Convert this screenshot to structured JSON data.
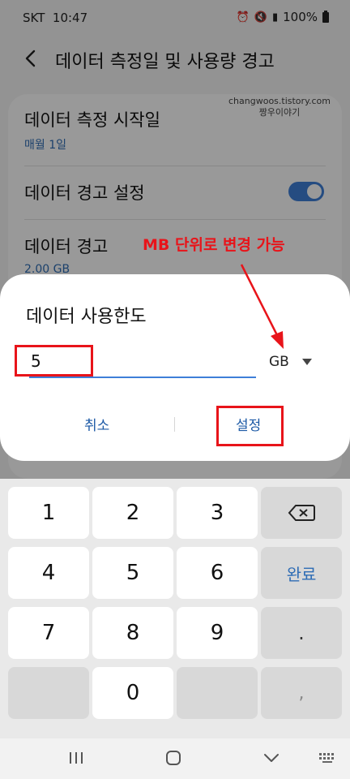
{
  "status_bar": {
    "carrier": "SKT",
    "time": "10:47",
    "battery": "100%",
    "icons": [
      "alarm-icon",
      "mute-icon",
      "signal-icon",
      "battery-icon"
    ]
  },
  "header": {
    "title": "데이터 측정일 및 사용량 경고",
    "back_icon": "chevron-left-icon"
  },
  "watermark": {
    "line1": "changwoos.tistory.com",
    "line2": "짱우이야기"
  },
  "settings": {
    "items": [
      {
        "title": "데이터 측정 시작일",
        "subtitle": "매월 1일"
      },
      {
        "title": "데이터 경고 설정",
        "toggle": true
      },
      {
        "title": "데이터 경고",
        "subtitle": "2.00 GB"
      }
    ]
  },
  "annotation": {
    "text": "MB 단위로 변경 가능",
    "color": "#e8141a"
  },
  "dialog": {
    "title": "데이터 사용한도",
    "input_value": "5",
    "unit": "GB",
    "cancel_label": "취소",
    "confirm_label": "설정"
  },
  "keyboard": {
    "keys": [
      "1",
      "2",
      "3",
      "4",
      "5",
      "6",
      "7",
      "8",
      "9",
      "0"
    ],
    "done_label": "완료",
    "dot_label": ".",
    "comma_label": ",",
    "backspace_icon": "backspace-icon"
  },
  "navbar": {
    "icons": [
      "recent-apps-icon",
      "home-icon",
      "back-down-icon",
      "keyboard-icon"
    ]
  },
  "colors": {
    "accent": "#3e7fd8",
    "link": "#1d5aa6",
    "highlight": "#e8141a"
  }
}
